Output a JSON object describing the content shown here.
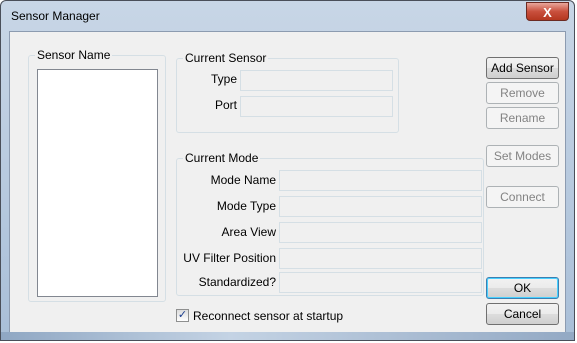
{
  "window": {
    "title": "Sensor Manager",
    "close_label": "X"
  },
  "sensor_list": {
    "label": "Sensor Name",
    "items": []
  },
  "current_sensor": {
    "label": "Current Sensor",
    "type_label": "Type",
    "type_value": "",
    "port_label": "Port",
    "port_value": ""
  },
  "current_mode": {
    "label": "Current Mode",
    "mode_name_label": "Mode Name",
    "mode_name_value": "",
    "mode_type_label": "Mode Type",
    "mode_type_value": "",
    "area_view_label": "Area View",
    "area_view_value": "",
    "uv_filter_label": "UV Filter Position",
    "uv_filter_value": "",
    "standardized_label": "Standardized?",
    "standardized_value": ""
  },
  "buttons": {
    "add_sensor": "Add Sensor",
    "remove": "Remove",
    "rename": "Rename",
    "set_modes": "Set Modes",
    "connect": "Connect",
    "ok": "OK",
    "cancel": "Cancel"
  },
  "reconnect": {
    "label": "Reconnect sensor at startup",
    "checked": true,
    "check_glyph": "✓"
  }
}
